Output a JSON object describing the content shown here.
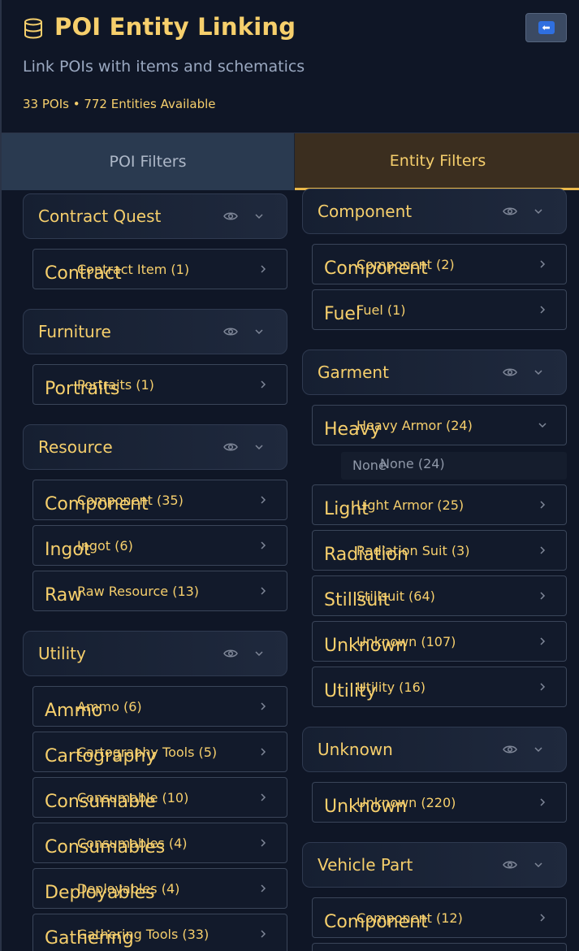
{
  "header": {
    "title": "POI Entity Linking",
    "subtitle": "Link POIs with items and schematics",
    "counts": "33 POIs • 772 Entities Available",
    "back_button_icon": "back-arrow-icon"
  },
  "tabs": [
    {
      "label": "POI Filters",
      "active": false
    },
    {
      "label": "Entity Filters",
      "active": true
    }
  ],
  "left_column": {
    "groups": [
      {
        "label": "Contract Quest",
        "items": [
          {
            "ghost": "Contract",
            "label": "Contract Item (1)"
          }
        ]
      },
      {
        "label": "Furniture",
        "items": [
          {
            "ghost": "Portraits",
            "label": "Portraits (1)"
          }
        ]
      },
      {
        "label": "Resource",
        "items": [
          {
            "ghost": "Component",
            "label": "Component (35)"
          },
          {
            "ghost": "Ingot",
            "label": "Ingot (6)"
          },
          {
            "ghost": "Raw",
            "label": "Raw Resource (13)"
          }
        ]
      },
      {
        "label": "Utility",
        "items": [
          {
            "ghost": "Ammo",
            "label": "Ammo (6)"
          },
          {
            "ghost": "Cartography",
            "label": "Cartography Tools (5)"
          },
          {
            "ghost": "Consumable",
            "label": "Consumable (10)"
          },
          {
            "ghost": "Consumables",
            "label": "Consumables (4)"
          },
          {
            "ghost": "Deployables",
            "label": "Deployables (4)"
          },
          {
            "ghost": "Gathering",
            "label": "Gathering Tools (33)"
          }
        ]
      }
    ]
  },
  "right_column": {
    "groups": [
      {
        "label": "Component",
        "items": [
          {
            "ghost": "Component",
            "label": "Component (2)"
          },
          {
            "ghost": "Fuel",
            "label": "Fuel (1)"
          }
        ]
      },
      {
        "label": "Garment",
        "items": [
          {
            "ghost": "Heavy",
            "label": "Heavy Armor (24)",
            "expanded": true,
            "children": [
              {
                "ghost": "None",
                "label": "None (24)"
              }
            ]
          },
          {
            "ghost": "Light",
            "label": "Light Armor (25)"
          },
          {
            "ghost": "Radiation",
            "label": "Radiation Suit (3)"
          },
          {
            "ghost": "Stillsuit",
            "label": "Stillsuit (64)"
          },
          {
            "ghost": "Unknown",
            "label": "Unknown (107)"
          },
          {
            "ghost": "Utility",
            "label": "Utility (16)"
          }
        ]
      },
      {
        "label": "Unknown",
        "items": [
          {
            "ghost": "Unknown",
            "label": "Unknown (220)"
          }
        ]
      },
      {
        "label": "Vehicle Part",
        "items": [
          {
            "ghost": "Component",
            "label": "Component (12)"
          }
        ]
      }
    ]
  },
  "colors": {
    "background": "#0f1626",
    "accent": "#f6cf6c",
    "active_tab_bg": "#3b2e1f",
    "active_tab_underline": "#e9b84a",
    "inactive_tab_bg": "#2a3a50"
  }
}
